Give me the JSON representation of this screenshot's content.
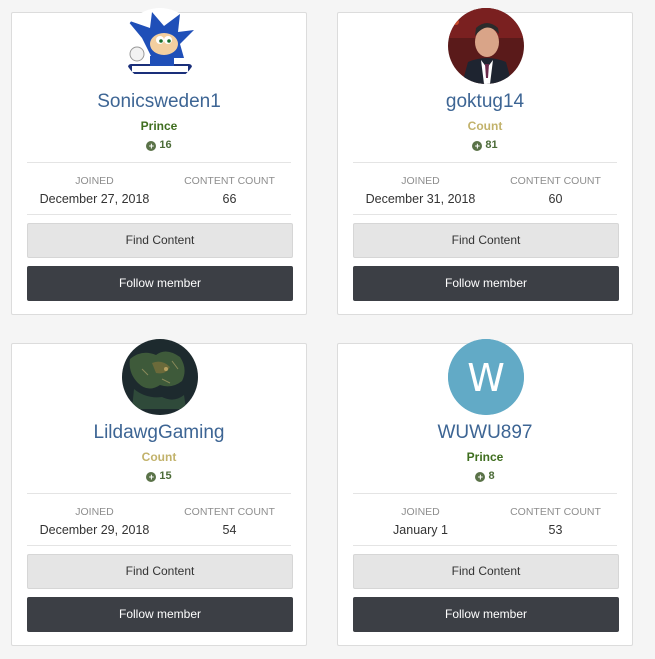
{
  "labels": {
    "joined": "JOINED",
    "content_count": "CONTENT COUNT",
    "find_content": "Find Content",
    "follow_member": "Follow member"
  },
  "colors": {
    "prince": "#3f6e1f",
    "count": "#c2b26b",
    "follow_button": "#3c3f45",
    "name_link": "#3d6594"
  },
  "members": [
    {
      "name": "Sonicsweden1",
      "rank": "Prince",
      "rank_color": "#3f6e1f",
      "reputation": "16",
      "joined": "December 27, 2018",
      "content_count": "66",
      "avatar": "sonic-avatar"
    },
    {
      "name": "goktug14",
      "rank": "Count",
      "rank_color": "#c2b26b",
      "reputation": "81",
      "joined": "December 31, 2018",
      "content_count": "60",
      "avatar": "photo-avatar"
    },
    {
      "name": "LildawgGaming",
      "rank": "Count",
      "rank_color": "#c2b26b",
      "reputation": "15",
      "joined": "December 29, 2018",
      "content_count": "54",
      "avatar": "map-avatar"
    },
    {
      "name": "WUWU897",
      "rank": "Prince",
      "rank_color": "#3f6e1f",
      "reputation": "8",
      "joined": "January 1",
      "content_count": "53",
      "avatar": "letter-avatar",
      "avatar_letter": "W"
    }
  ]
}
